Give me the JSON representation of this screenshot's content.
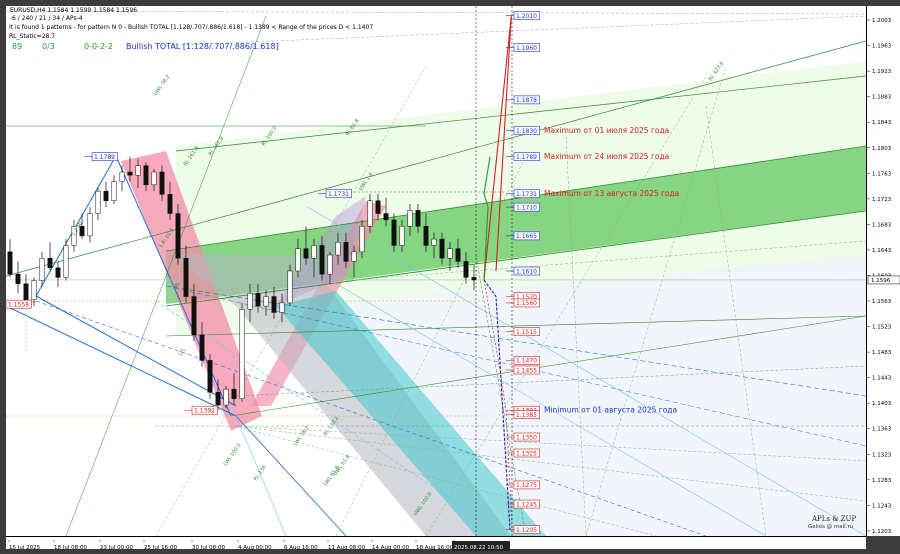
{
  "header": {
    "symbol_line": "EURUSD,H4  1.1584 1.1599 1.1584 1.1596",
    "params_line": "6 / 240 / 21 / 34 / APs-4",
    "pattern_line": "It is found 1 patterns  -  for pattern N 0 - Bullish TOTAL [1.128/.707/.886/1.618] - 1.1389 < Range of the prices D < 1.1407",
    "rl_static": "RL_Static=28.7",
    "count1": "89",
    "count2": "0/3",
    "count3": "0-0-2-2",
    "pattern_name": "Bullish TOTAL [1.128/.707/.886/1.618]"
  },
  "watermark": {
    "line1": "APLs & ZUP",
    "line2": "Gelios @ mail.ru"
  },
  "colors": {
    "bull": "#1a1a1a",
    "bear": "#1a1a1a",
    "up_target": "#d42020",
    "down_target": "#2020c0",
    "green_band": "#2fb52f",
    "pink_band": "#f48ca8",
    "cyan_band": "#3fc8cc"
  },
  "chart_data": {
    "type": "candlestick",
    "symbol": "EURUSD",
    "timeframe": "H4",
    "ylim": [
      1.1195,
      1.2025
    ],
    "y_ticks": [
      1.2003,
      1.1963,
      1.1923,
      1.1883,
      1.1843,
      1.1803,
      1.1763,
      1.1723,
      1.1683,
      1.1643,
      1.1603,
      1.1563,
      1.1523,
      1.1483,
      1.1443,
      1.1403,
      1.1363,
      1.1323,
      1.1283,
      1.1243,
      1.1203
    ],
    "current_price": "1.1596",
    "x_labels": [
      "15 Jul 2025",
      "18 Jul 08:00",
      "23 Jul 00:00",
      "25 Jul 16:00",
      "30 Jul 08:00",
      "4 Aug 00:00",
      "6 Aug 16:00",
      "11 Aug 08:00",
      "14 Aug 00:00",
      "18 Aug 16:00",
      "2025.08.22 10:50"
    ],
    "pivot_levels": [
      {
        "label": "1.1789",
        "value": 1.1789
      },
      {
        "label": "1.1731",
        "value": 1.1731
      },
      {
        "label": "1.1558",
        "value": 1.1558
      },
      {
        "label": "1.1392",
        "value": 1.1392
      }
    ],
    "up_targets": [
      "1.2010",
      "1.1960",
      "1.1878",
      "1.1830",
      "1.1789",
      "1.1731",
      "1.1710",
      "1.1665",
      "1.1610"
    ],
    "down_targets": [
      "1.1570",
      "1.1560",
      "1.1515",
      "1.1470",
      "1.1455",
      "1.1392",
      "1.1385",
      "1.1350",
      "1.1325",
      "1.1275",
      "1.1245",
      "1.1205"
    ],
    "annotations": [
      {
        "text": "Maximum от 01 июля 2025 года",
        "value": 1.183
      },
      {
        "text": "Maximum от 24 июля 2025 года",
        "value": 1.1789
      },
      {
        "text": "Maximum от 13 августа 2025 года",
        "value": 1.1731
      },
      {
        "text": "Minimum от 01 августа 2025 года",
        "value": 1.1392
      }
    ],
    "line_labels": [
      "UWL 38.2",
      "UWL 61.8",
      "UWL 100.0",
      "LWL 38.2",
      "LWL 61.8",
      "LWL 100.0",
      "ML",
      "LTL",
      "1.2 ML",
      "RL 61.8",
      "RL 100.0",
      "RL 161.8",
      "RL 261.8",
      "RL 236",
      "RL 138.2",
      "RL 423.6",
      "UWL 1.6",
      "1.6: 61.8"
    ],
    "candles": [
      [
        1.164,
        1.166,
        1.16,
        1.1605
      ],
      [
        1.1605,
        1.1625,
        1.1575,
        1.159
      ],
      [
        1.159,
        1.1605,
        1.156,
        1.1565
      ],
      [
        1.1565,
        1.16,
        1.1555,
        1.1595
      ],
      [
        1.1595,
        1.164,
        1.1585,
        1.163
      ],
      [
        1.163,
        1.1655,
        1.161,
        1.1615
      ],
      [
        1.1615,
        1.1625,
        1.1585,
        1.16
      ],
      [
        1.16,
        1.166,
        1.1595,
        1.165
      ],
      [
        1.165,
        1.169,
        1.164,
        1.168
      ],
      [
        1.168,
        1.17,
        1.166,
        1.1665
      ],
      [
        1.1665,
        1.171,
        1.1655,
        1.17
      ],
      [
        1.17,
        1.174,
        1.169,
        1.1735
      ],
      [
        1.1735,
        1.175,
        1.171,
        1.172
      ],
      [
        1.172,
        1.176,
        1.1715,
        1.175
      ],
      [
        1.175,
        1.1775,
        1.1735,
        1.1765
      ],
      [
        1.1765,
        1.1789,
        1.175,
        1.176
      ],
      [
        1.176,
        1.1785,
        1.174,
        1.1775
      ],
      [
        1.1775,
        1.178,
        1.1735,
        1.1745
      ],
      [
        1.1745,
        1.177,
        1.1735,
        1.1765
      ],
      [
        1.1765,
        1.1775,
        1.172,
        1.173
      ],
      [
        1.173,
        1.175,
        1.169,
        1.17
      ],
      [
        1.17,
        1.1715,
        1.162,
        1.163
      ],
      [
        1.163,
        1.165,
        1.156,
        1.157
      ],
      [
        1.157,
        1.159,
        1.15,
        1.151
      ],
      [
        1.151,
        1.153,
        1.146,
        1.147
      ],
      [
        1.147,
        1.148,
        1.141,
        1.142
      ],
      [
        1.142,
        1.144,
        1.1392,
        1.14
      ],
      [
        1.14,
        1.143,
        1.1395,
        1.1425
      ],
      [
        1.1425,
        1.145,
        1.14,
        1.141
      ],
      [
        1.141,
        1.156,
        1.1405,
        1.155
      ],
      [
        1.155,
        1.159,
        1.153,
        1.1575
      ],
      [
        1.1575,
        1.159,
        1.1545,
        1.1555
      ],
      [
        1.1555,
        1.158,
        1.154,
        1.157
      ],
      [
        1.157,
        1.1585,
        1.1535,
        1.1545
      ],
      [
        1.1545,
        1.1575,
        1.153,
        1.156
      ],
      [
        1.156,
        1.162,
        1.1555,
        1.161
      ],
      [
        1.161,
        1.166,
        1.16,
        1.1645
      ],
      [
        1.1645,
        1.168,
        1.162,
        1.163
      ],
      [
        1.163,
        1.166,
        1.16,
        1.165
      ],
      [
        1.165,
        1.1665,
        1.1595,
        1.1605
      ],
      [
        1.1605,
        1.164,
        1.159,
        1.1635
      ],
      [
        1.1635,
        1.167,
        1.162,
        1.1655
      ],
      [
        1.1655,
        1.167,
        1.1615,
        1.1625
      ],
      [
        1.1625,
        1.165,
        1.16,
        1.164
      ],
      [
        1.164,
        1.169,
        1.163,
        1.168
      ],
      [
        1.168,
        1.1731,
        1.167,
        1.172
      ],
      [
        1.172,
        1.1731,
        1.169,
        1.17
      ],
      [
        1.17,
        1.1725,
        1.168,
        1.169
      ],
      [
        1.169,
        1.17,
        1.164,
        1.165
      ],
      [
        1.165,
        1.169,
        1.164,
        1.168
      ],
      [
        1.168,
        1.1715,
        1.1665,
        1.1705
      ],
      [
        1.1705,
        1.1715,
        1.167,
        1.168
      ],
      [
        1.168,
        1.17,
        1.164,
        1.165
      ],
      [
        1.165,
        1.167,
        1.163,
        1.166
      ],
      [
        1.166,
        1.167,
        1.162,
        1.163
      ],
      [
        1.163,
        1.1655,
        1.161,
        1.1645
      ],
      [
        1.1645,
        1.166,
        1.1615,
        1.1625
      ],
      [
        1.1625,
        1.164,
        1.159,
        1.16
      ],
      [
        1.16,
        1.162,
        1.158,
        1.1596
      ]
    ]
  }
}
